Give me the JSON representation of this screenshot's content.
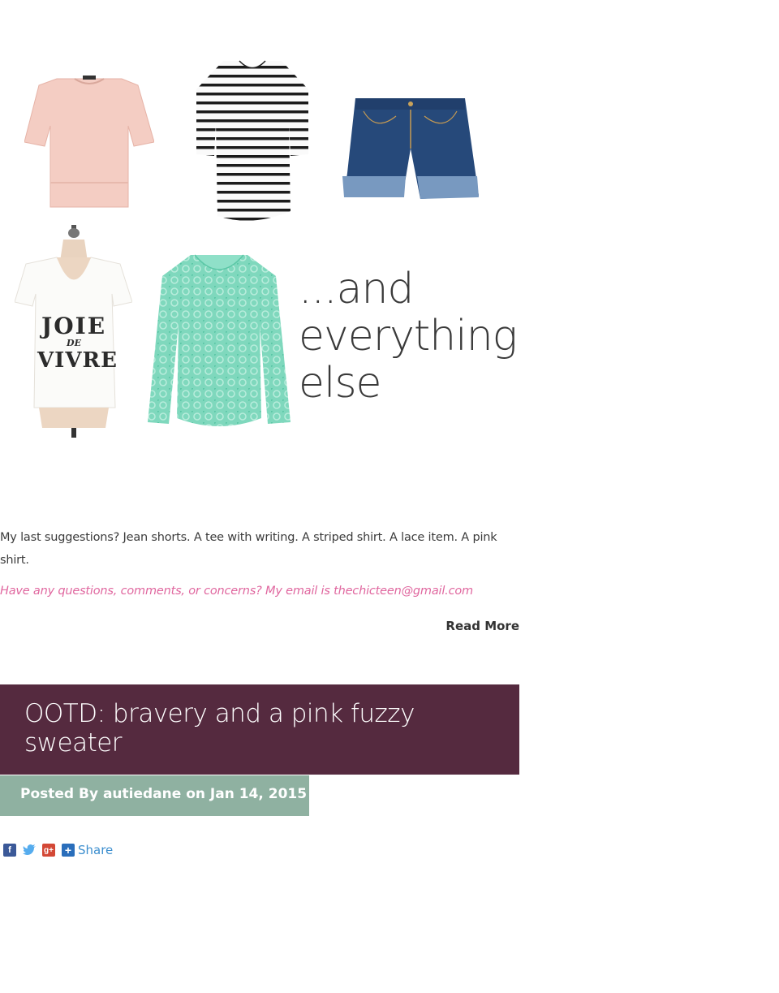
{
  "collage": {
    "text_lines": [
      "...and",
      "everything",
      "else"
    ],
    "tee_text": [
      "JOIE",
      "DE",
      "VIVRE"
    ]
  },
  "post": {
    "paragraph_1": "My last suggestions? Jean shorts. A tee with writing. A striped shirt. A lace item. A pink shirt.",
    "paragraph_2": "Have any questions, comments, or concerns? My email is thechicteen@gmail.com",
    "read_more": "Read More"
  },
  "next_post": {
    "title": "OOTD: bravery and a pink fuzzy sweater",
    "meta": "Posted By autiedane on Jan 14, 2015"
  },
  "share": {
    "label": "Share",
    "icons": [
      "facebook-icon",
      "twitter-icon",
      "google-plus-icon",
      "share-plus-icon"
    ]
  },
  "colors": {
    "title_bg": "#552a3f",
    "meta_bg": "#8fb1a1",
    "email_pink": "#e0679f",
    "share_blue": "#3d8fcf"
  }
}
